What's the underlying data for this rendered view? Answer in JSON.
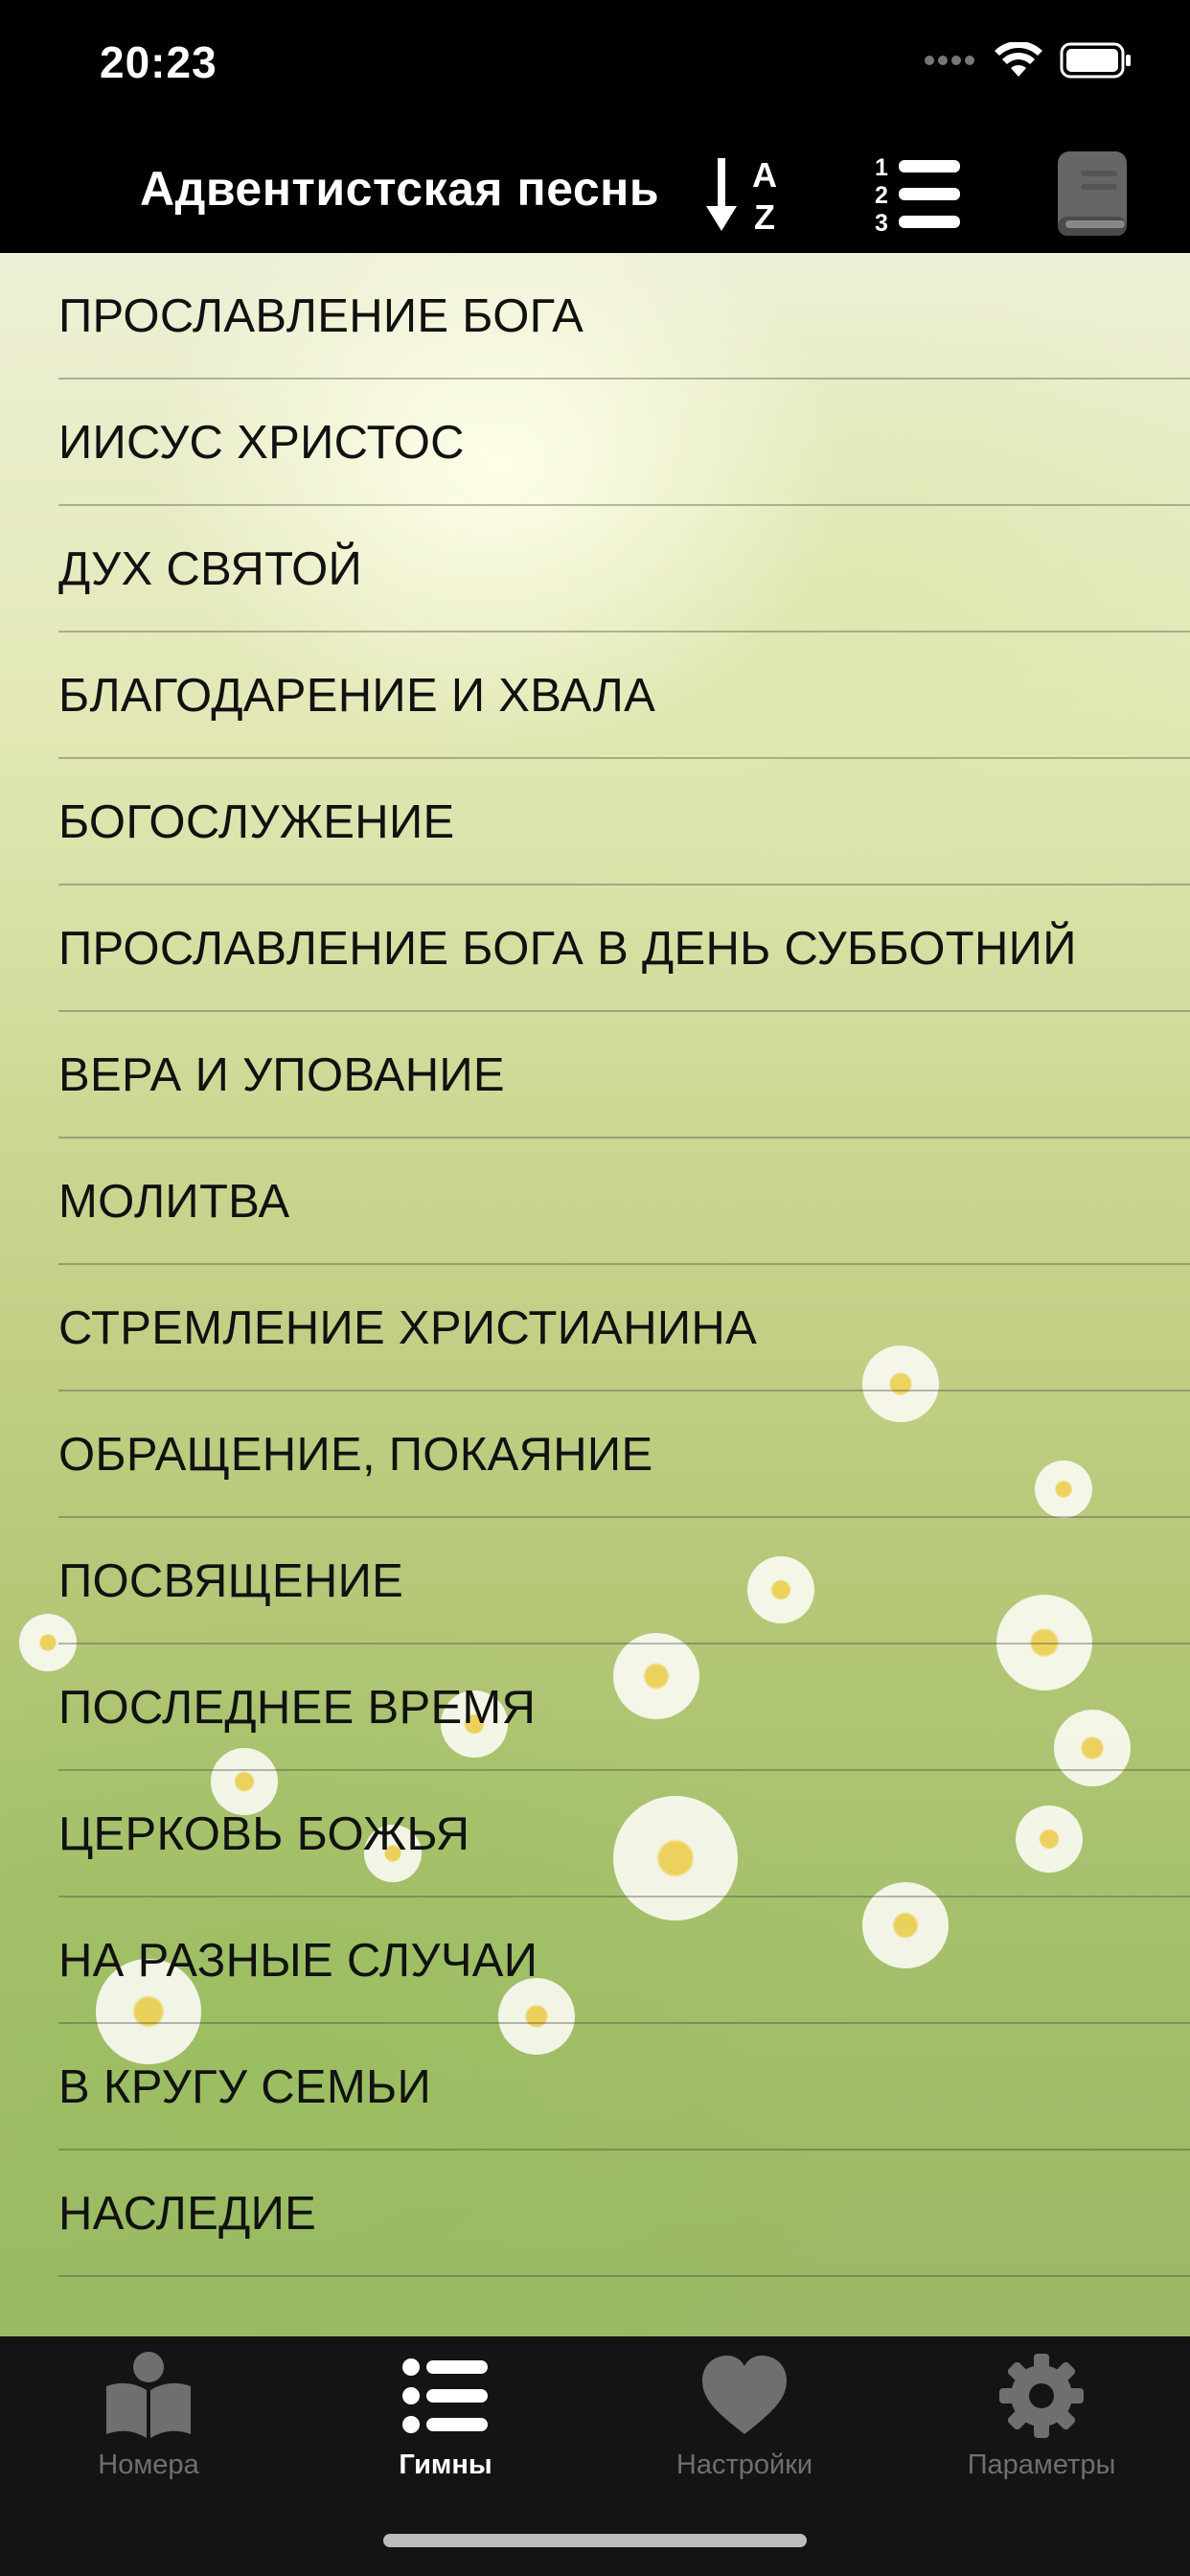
{
  "status_bar": {
    "time": "20:23"
  },
  "nav": {
    "title": "Адвентистская песнь",
    "sort_az_letters": [
      "A",
      "Z"
    ],
    "sort_num_digits": [
      "1",
      "2",
      "3"
    ]
  },
  "categories": [
    "ПРОСЛАВЛЕНИЕ БОГА",
    "ИИСУС ХРИСТОС",
    "ДУХ СВЯТОЙ",
    "БЛАГОДАРЕНИЕ И ХВАЛА",
    "БОГОСЛУЖЕНИЕ",
    "ПРОСЛАВЛЕНИЕ БОГА В ДЕНЬ СУББОТНИЙ",
    "ВЕРА И УПОВАНИЕ",
    "МОЛИТВА",
    "СТРЕМЛЕНИЕ ХРИСТИАНИНА",
    "ОБРАЩЕНИЕ, ПОКАЯНИЕ",
    "ПОСВЯЩЕНИЕ",
    "ПОСЛЕДНЕЕ ВРЕМЯ",
    "ЦЕРКОВЬ БОЖЬЯ",
    "НА РАЗНЫЕ СЛУЧАИ",
    "В КРУГУ СЕМЬИ",
    "НАСЛЕДИЕ"
  ],
  "tabs": [
    {
      "label": "Номера",
      "icon": "open-book-icon",
      "active": false
    },
    {
      "label": "Гимны",
      "icon": "list-icon",
      "active": true
    },
    {
      "label": "Настройки",
      "icon": "heart-icon",
      "active": false
    },
    {
      "label": "Параметры",
      "icon": "gear-icon",
      "active": false
    }
  ],
  "colors": {
    "bar_background": "#000000",
    "tab_bar_background": "#141414",
    "tab_active": "#ffffff",
    "tab_inactive": "#6f6f6f",
    "row_text": "#111111"
  }
}
